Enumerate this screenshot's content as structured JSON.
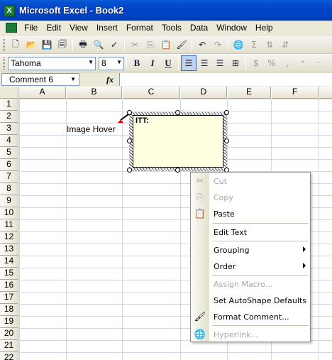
{
  "window": {
    "title": "Microsoft Excel - Book2",
    "app_icon": "excel-icon"
  },
  "menu": [
    "File",
    "Edit",
    "View",
    "Insert",
    "Format",
    "Tools",
    "Data",
    "Window",
    "Help"
  ],
  "toolbar": {
    "font_name": "Tahoma",
    "font_size": "8",
    "bold": "B",
    "italic": "I",
    "underline": "U"
  },
  "formula_bar": {
    "name_box": "Comment 6",
    "fx": "fx",
    "formula": ""
  },
  "columns": [
    "A",
    "B",
    "C",
    "D",
    "E",
    "F"
  ],
  "rows": [
    "1",
    "2",
    "3",
    "4",
    "5",
    "6",
    "7",
    "8",
    "9",
    "10",
    "11",
    "12",
    "13",
    "14",
    "15",
    "16",
    "17",
    "18",
    "19",
    "20",
    "21",
    "22"
  ],
  "cells": {
    "B3": "Image Hover"
  },
  "comment": {
    "text": "ITT:",
    "fill": "#ffffe1"
  },
  "context_menu": {
    "items": [
      {
        "label": "Cut",
        "enabled": false,
        "icon": "scissors-icon"
      },
      {
        "label": "Copy",
        "enabled": false,
        "icon": "copy-icon"
      },
      {
        "label": "Paste",
        "enabled": true,
        "icon": "paste-icon"
      },
      {
        "label": "Edit Text",
        "enabled": true,
        "icon": ""
      },
      {
        "label": "Grouping",
        "enabled": true,
        "icon": "",
        "submenu": true
      },
      {
        "label": "Order",
        "enabled": true,
        "icon": "",
        "submenu": true
      },
      {
        "label": "Assign Macro...",
        "enabled": false,
        "icon": ""
      },
      {
        "label": "Set AutoShape Defaults",
        "enabled": true,
        "icon": ""
      },
      {
        "label": "Format Comment...",
        "enabled": true,
        "icon": "format-comment-icon"
      },
      {
        "label": "Hyperlink...",
        "enabled": false,
        "icon": "hyperlink-icon"
      }
    ]
  },
  "colors": {
    "titlebar": "#0043c4",
    "chrome": "#ece9d8",
    "gridline": "#d0d7e5"
  }
}
